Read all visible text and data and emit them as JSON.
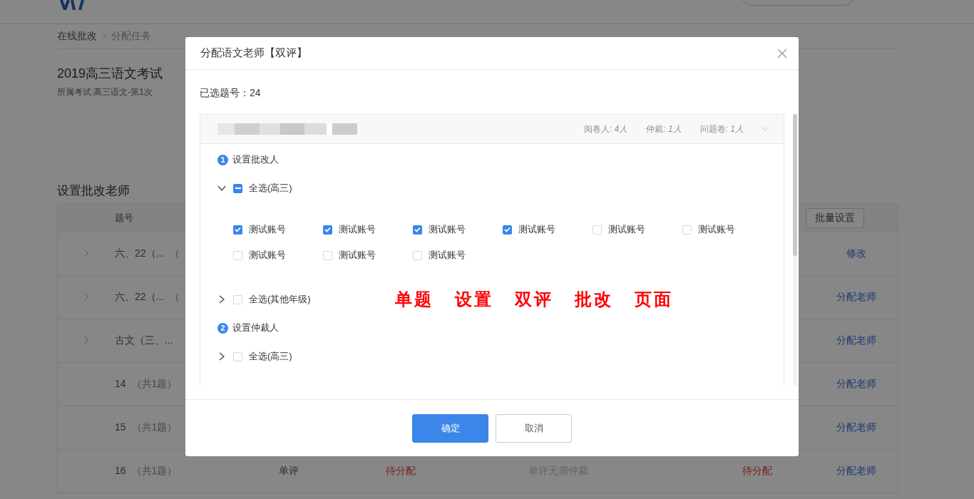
{
  "breadcrumb": [
    "在线批改",
    "分配任务"
  ],
  "exam": {
    "title": "2019高三语文考试",
    "subtitle": "所属考试:高三语文-第1次"
  },
  "section_title": "设置批改老师",
  "table": {
    "columns": [
      "题号"
    ],
    "batch_button": "批量设置",
    "rows": [
      {
        "expandable": true,
        "title": "六、22（...",
        "count": "（",
        "action": "修改"
      },
      {
        "expandable": true,
        "title": "六、22（...",
        "count": "（",
        "action": "分配老师"
      },
      {
        "expandable": true,
        "title": "古文（三、...",
        "action": "分配老师"
      },
      {
        "expandable": false,
        "title": "14",
        "count": "（共1题）",
        "action": "分配老师"
      },
      {
        "expandable": false,
        "title": "15",
        "count": "（共1题）",
        "action": "分配老师"
      },
      {
        "expandable": false,
        "title": "16",
        "count": "（共1题）",
        "type": "单评",
        "status": "待分配",
        "arbitration": "单评无需仲裁",
        "arbitration_status": "待分配",
        "action": "分配老师"
      }
    ]
  },
  "dialog": {
    "title": "分配语文老师【双评】",
    "selected": "已选题号：24",
    "panel": {
      "stats": [
        "阅卷人: *4人*",
        "仲裁: *1人*",
        "问题卷: *1人*"
      ],
      "sections": [
        {
          "number": "1",
          "title": "设置批改人",
          "groups": [
            {
              "label": "全选(高三)",
              "expanded": true,
              "indeterminate": true,
              "accounts": [
                {
                  "label": "测试账号",
                  "checked": true
                },
                {
                  "label": "测试账号",
                  "checked": true
                },
                {
                  "label": "测试账号",
                  "checked": true
                },
                {
                  "label": "测试账号",
                  "checked": true
                },
                {
                  "label": "测试账号",
                  "checked": false
                },
                {
                  "label": "测试账号",
                  "checked": false
                },
                {
                  "label": "测试账号",
                  "checked": false
                },
                {
                  "label": "测试账号",
                  "checked": false
                },
                {
                  "label": "测试账号",
                  "checked": false
                }
              ]
            },
            {
              "label": "全选(其他年级)",
              "expanded": false,
              "checked": false,
              "indeterminate": false,
              "annotation": [
                "单题",
                "设置",
                "双评",
                "批改",
                "页面"
              ]
            }
          ]
        },
        {
          "number": "2",
          "title": "设置仲裁人",
          "groups": [
            {
              "label": "全选(高三)",
              "expanded": false,
              "checked": false,
              "indeterminate": false
            }
          ]
        }
      ]
    },
    "buttons": [
      {
        "label": "确定",
        "kind": "primary"
      },
      {
        "label": "取消",
        "kind": "default"
      }
    ]
  }
}
